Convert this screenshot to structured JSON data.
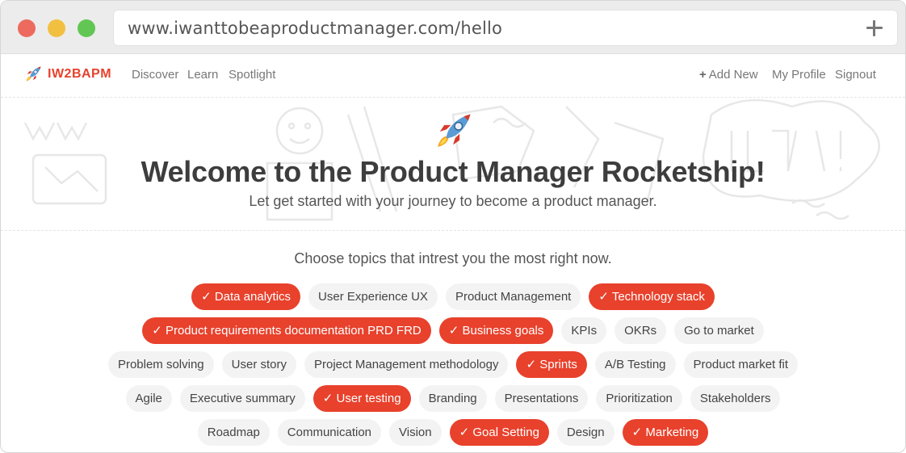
{
  "browser": {
    "url": "www.iwanttobeaproductmanager.com/hello"
  },
  "navbar": {
    "brand": "IW2BAPM",
    "links": [
      "Discover",
      "Learn",
      "Spotlight"
    ],
    "add_new": "Add New",
    "my_profile": "My Profile",
    "signout": "Signout"
  },
  "hero": {
    "title": "Welcome to the Product Manager Rocketship!",
    "subtitle": "Let get started with your journey to become a product manager."
  },
  "topics": {
    "heading": "Choose topics that intrest you the most right now.",
    "check_mark": "✓",
    "rows": [
      [
        {
          "label": "Data analytics",
          "selected": true
        },
        {
          "label": "User Experience UX",
          "selected": false
        },
        {
          "label": "Product Management",
          "selected": false
        },
        {
          "label": "Technology stack",
          "selected": true
        }
      ],
      [
        {
          "label": "Product requirements documentation PRD FRD",
          "selected": true
        },
        {
          "label": "Business goals",
          "selected": true
        },
        {
          "label": "KPIs",
          "selected": false
        },
        {
          "label": "OKRs",
          "selected": false
        },
        {
          "label": "Go to market",
          "selected": false
        }
      ],
      [
        {
          "label": "Problem solving",
          "selected": false
        },
        {
          "label": "User story",
          "selected": false
        },
        {
          "label": "Project Management methodology",
          "selected": false
        },
        {
          "label": "Sprints",
          "selected": true
        },
        {
          "label": "A/B Testing",
          "selected": false
        },
        {
          "label": "Product market fit",
          "selected": false
        }
      ],
      [
        {
          "label": "Agile",
          "selected": false
        },
        {
          "label": "Executive summary",
          "selected": false
        },
        {
          "label": "User testing",
          "selected": true
        },
        {
          "label": "Branding",
          "selected": false
        },
        {
          "label": "Presentations",
          "selected": false
        },
        {
          "label": "Prioritization",
          "selected": false
        },
        {
          "label": "Stakeholders",
          "selected": false
        }
      ],
      [
        {
          "label": "Roadmap",
          "selected": false
        },
        {
          "label": "Communication",
          "selected": false
        },
        {
          "label": "Vision",
          "selected": false
        },
        {
          "label": "Goal Setting",
          "selected": true
        },
        {
          "label": "Design",
          "selected": false
        },
        {
          "label": "Marketing",
          "selected": true
        }
      ]
    ]
  },
  "colors": {
    "accent": "#e8412c",
    "chip_bg": "#f3f3f3"
  },
  "icons": {
    "logo": "rocket-icon",
    "hero": "rocket-icon",
    "add": "plus-icon"
  }
}
